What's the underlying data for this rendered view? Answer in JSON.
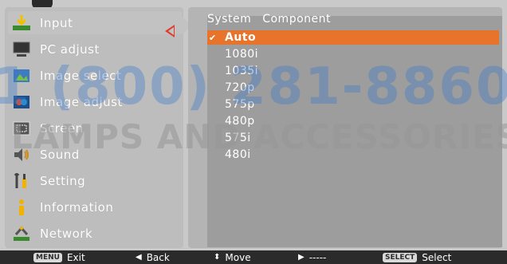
{
  "menu": {
    "items": [
      {
        "label": "Input",
        "icon": "input-icon"
      },
      {
        "label": "PC adjust",
        "icon": "pc-adjust-icon"
      },
      {
        "label": "Image select",
        "icon": "image-select-icon"
      },
      {
        "label": "Image adjust",
        "icon": "image-adjust-icon"
      },
      {
        "label": "Screen",
        "icon": "screen-icon"
      },
      {
        "label": "Sound",
        "icon": "sound-icon"
      },
      {
        "label": "Setting",
        "icon": "setting-icon"
      },
      {
        "label": "Information",
        "icon": "information-icon"
      },
      {
        "label": "Network",
        "icon": "network-icon"
      }
    ],
    "selected_index": 0
  },
  "panel": {
    "title_left": "System",
    "title_right": "Component",
    "options": [
      "Auto",
      "1080i",
      "1035i",
      "720p",
      "575p",
      "480p",
      "575i",
      "480i"
    ],
    "selected_option": "Auto",
    "check_mark": "✔"
  },
  "footer": {
    "exit_badge": "MENU",
    "exit_label": "Exit",
    "back_label": "Back",
    "move_label": "Move",
    "next_label": "-----",
    "select_badge": "SELECT",
    "select_label": "Select"
  },
  "watermark": {
    "phone": "1 (800) 281-8860",
    "brand": "LAMPS AND ACCESSORIES"
  },
  "colors": {
    "highlight": "#e8732a",
    "chevron": "#e23c2a"
  }
}
